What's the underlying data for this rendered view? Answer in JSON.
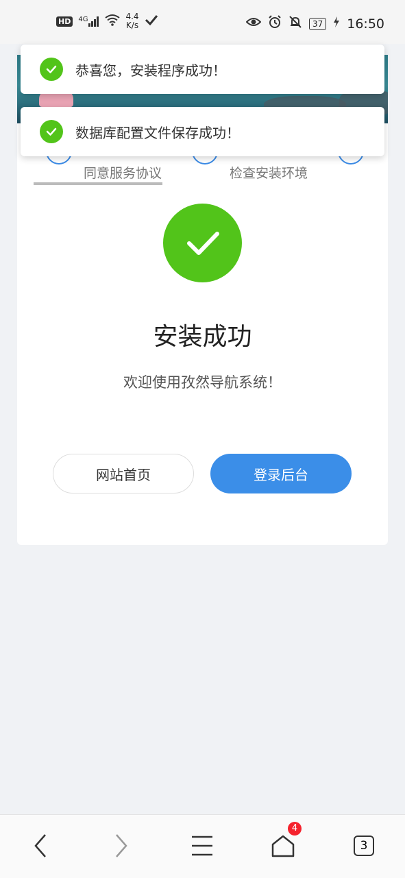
{
  "status_bar": {
    "hd": "HD",
    "network": "4G",
    "speed_value": "4.4",
    "speed_unit": "K/s",
    "battery": "37",
    "time": "16:50"
  },
  "steps": [
    {
      "label": "同意服务协议"
    },
    {
      "label": "检查安装环境"
    }
  ],
  "result": {
    "title": "安装成功",
    "subtitle": "欢迎使用孜然导航系统！"
  },
  "buttons": {
    "home": "网站首页",
    "admin": "登录后台"
  },
  "toasts": [
    {
      "text": "恭喜您，安装程序成功！"
    },
    {
      "text": "数据库配置文件保存成功！"
    }
  ],
  "browser_nav": {
    "home_badge": "4",
    "tab_count": "3"
  },
  "colors": {
    "success": "#52c41a",
    "primary": "#3b8ee8"
  }
}
